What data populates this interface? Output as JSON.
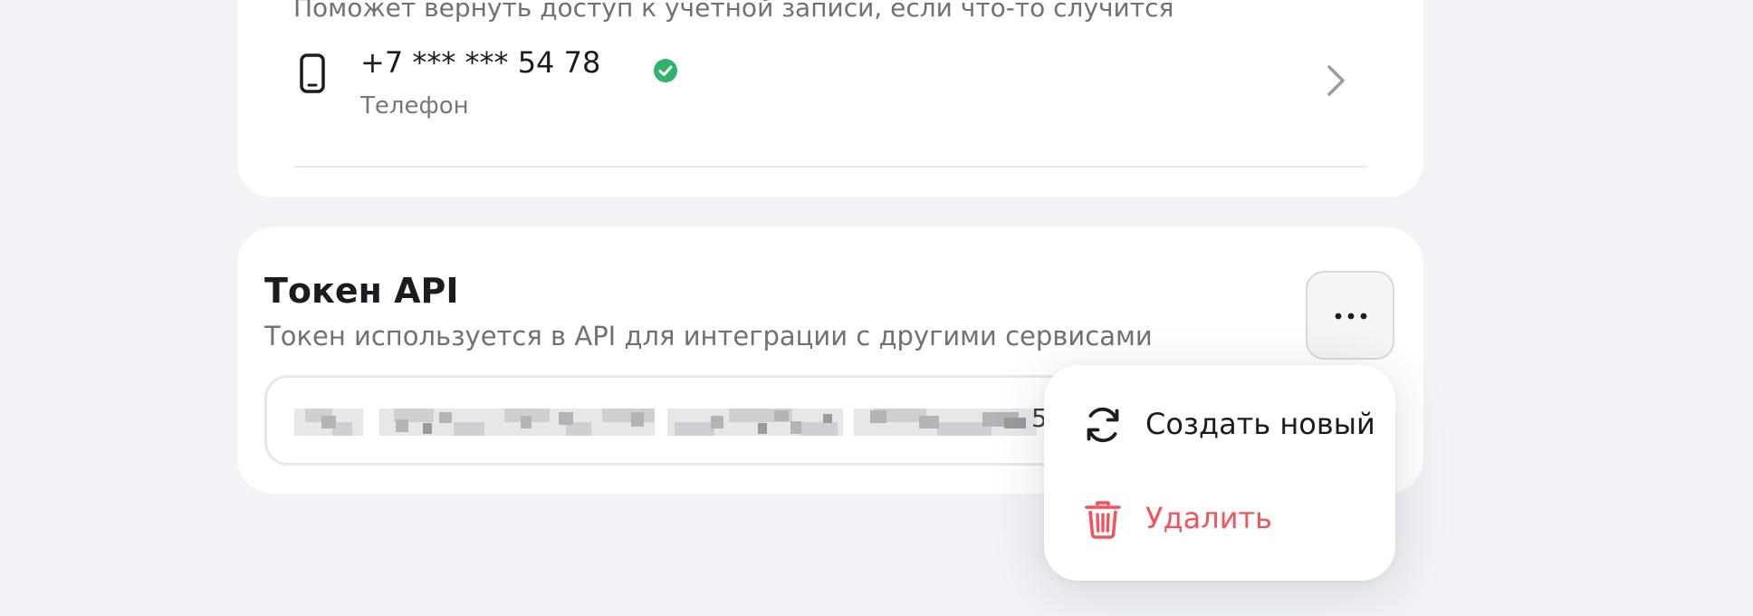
{
  "recovery": {
    "partial_description": "Поможет вернуть доступ к учетной записи, если что-то случится",
    "phone": {
      "number": "+7 *** *** 54 78",
      "caption": "Телефон",
      "verified": true
    }
  },
  "api_token": {
    "title": "Токен API",
    "description": "Токен используется в API для интеграции с другими сервисами",
    "value_visible_tail": "5",
    "menu_button_icon": "more-horizontal-icon",
    "menu": {
      "create_label": "Создать новый",
      "create_icon": "refresh-icon",
      "delete_label": "Удалить",
      "delete_icon": "trash-icon"
    }
  },
  "colors": {
    "background": "#f1f3f6",
    "verified": "#2fb36b",
    "danger": "#f2545b",
    "text_primary": "#1b1c21",
    "text_secondary": "#6f7178"
  }
}
